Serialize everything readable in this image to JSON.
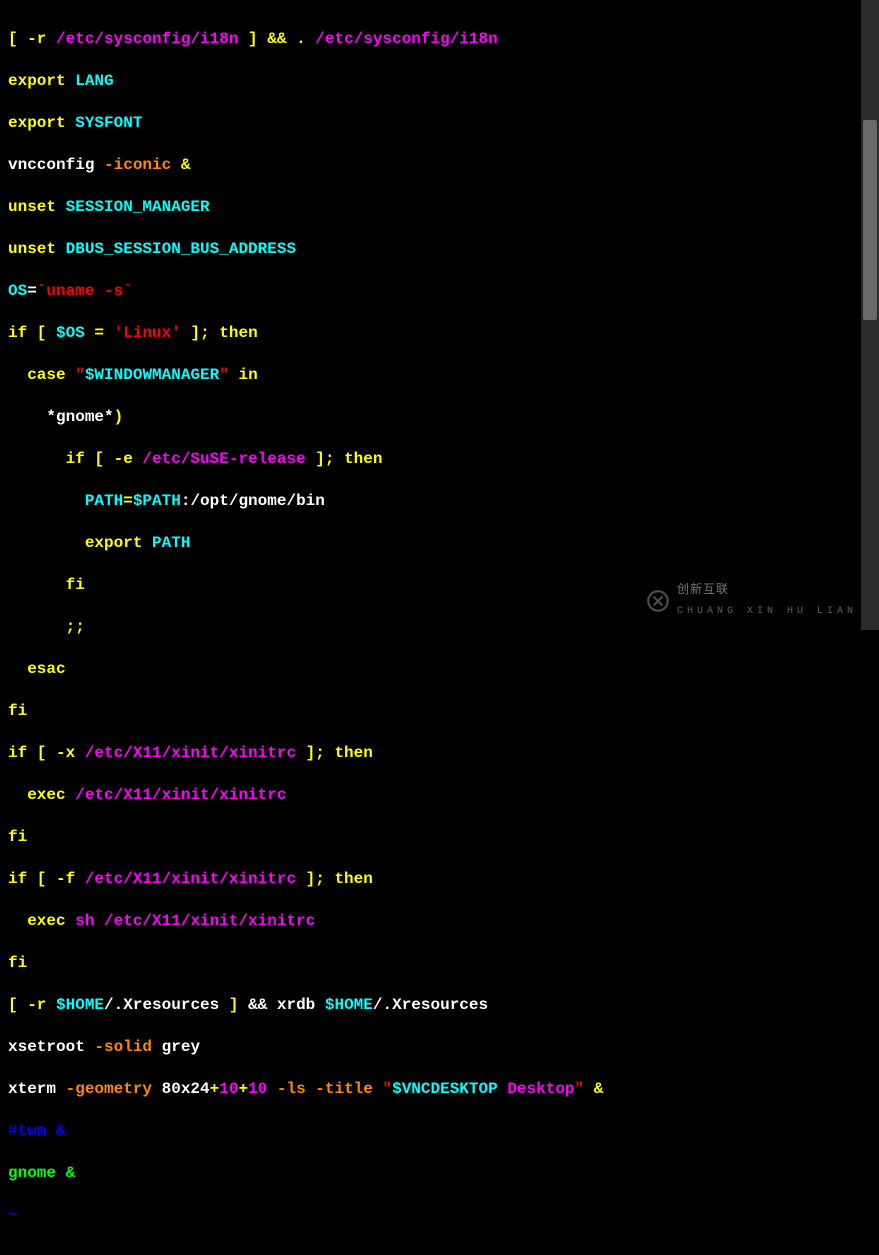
{
  "code": {
    "l1": {
      "a": "[ -r ",
      "b": "/etc/sysconfig/i18n",
      "c": " ] ",
      "d": "&& ",
      "e": ". ",
      "f": "/etc/sysconfig/i18n"
    },
    "l2": {
      "a": "export ",
      "b": "LANG"
    },
    "l3": {
      "a": "export ",
      "b": "SYSFONT"
    },
    "l4": {
      "a": "vncconfig ",
      "b": "-iconic ",
      "c": "&"
    },
    "l5": {
      "a": "unset ",
      "b": "SESSION_MANAGER"
    },
    "l6": {
      "a": "unset ",
      "b": "DBUS_SESSION_BUS_ADDRESS"
    },
    "l7": {
      "a": "OS",
      "b": "=",
      "c": "`uname -s`"
    },
    "l8": {
      "a": "if [ ",
      "b": "$OS",
      "c": " = ",
      "d": "'Linux'",
      "e": " ]; ",
      "f": "then"
    },
    "l9": {
      "a": "  case ",
      "b": "\"",
      "c": "$WINDOWMANAGER",
      "d": "\"",
      "e": " in"
    },
    "l10": {
      "a": "    *gnome*",
      "b": ")"
    },
    "l11": {
      "a": "      if [ -e ",
      "b": "/etc/SuSE-release",
      "c": " ]; ",
      "d": "then"
    },
    "l12": {
      "a": "        ",
      "b": "PATH",
      "c": "=",
      "d": "$PATH",
      "e": ":/opt/gnome/bin"
    },
    "l13": {
      "a": "        export ",
      "b": "PATH"
    },
    "l14": {
      "a": "      fi"
    },
    "l15": {
      "a": "      ;;"
    },
    "l16": {
      "a": "  esac"
    },
    "l17": {
      "a": "fi"
    },
    "l18": {
      "a": "if [ -x ",
      "b": "/etc/X11/xinit/xinitrc",
      "c": " ]; ",
      "d": "then"
    },
    "l19": {
      "a": "  exec ",
      "b": "/etc/X11/xinit/xinitrc"
    },
    "l20": {
      "a": "fi"
    },
    "l21": {
      "a": "if [ -f ",
      "b": "/etc/X11/xinit/xinitrc",
      "c": " ]; ",
      "d": "then"
    },
    "l22": {
      "a": "  exec ",
      "b": "sh /etc/X11/xinit/xinitrc"
    },
    "l23": {
      "a": "fi"
    },
    "l24": {
      "a": "[ -r ",
      "b": "$HOME",
      "c": "/.Xresources",
      "d": " ] ",
      "e": "&& xrdb ",
      "f": "$HOME",
      "g": "/.Xresources"
    },
    "l25": {
      "a": "xsetroot ",
      "b": "-solid ",
      "c": "grey"
    },
    "l26": {
      "a": "xterm ",
      "b": "-geometry ",
      "c": "80x24",
      "d": "+",
      "e": "10",
      "f": "+",
      "g": "10",
      "h": " -ls -title ",
      "i": "\"",
      "j": "$VNCDESKTOP",
      "k": " Desktop",
      "l": "\"",
      "m": " &"
    },
    "l27": {
      "a": "#twm &"
    },
    "l28": {
      "a": "gnome &"
    },
    "l29": {
      "a": "~"
    }
  },
  "watermark": {
    "brand": "创新互联",
    "sub": "CHUANG XIN HU LIAN"
  }
}
